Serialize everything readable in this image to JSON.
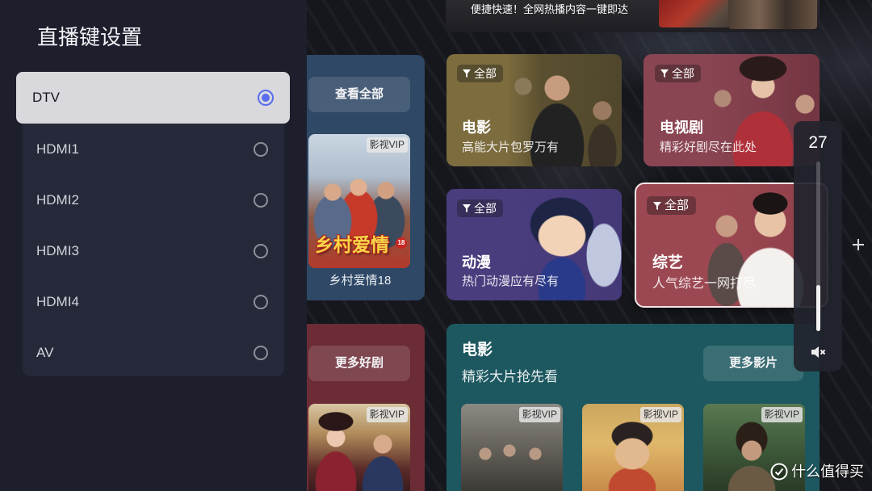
{
  "settings_panel": {
    "title": "直播键设置",
    "options": [
      {
        "label": "DTV",
        "selected": true
      },
      {
        "label": "HDMI1",
        "selected": false
      },
      {
        "label": "HDMI2",
        "selected": false
      },
      {
        "label": "HDMI3",
        "selected": false
      },
      {
        "label": "HDMI4",
        "selected": false
      },
      {
        "label": "AV",
        "selected": false
      }
    ]
  },
  "banner": {
    "text": "便捷快速！全网热播内容一键即达"
  },
  "featured_card": {
    "button": "查看全部",
    "poster": {
      "badge": "影视VIP",
      "title": "乡村爱情",
      "episode": "18"
    },
    "caption": "乡村爱情18"
  },
  "drama_card": {
    "button": "更多好剧",
    "poster": {
      "badge": "影视VIP"
    }
  },
  "categories": [
    {
      "filter": "全部",
      "title": "电影",
      "subtitle": "高能大片包罗万有",
      "color": "#7c6c3e",
      "focused": false
    },
    {
      "filter": "全部",
      "title": "电视剧",
      "subtitle": "精彩好剧尽在此处",
      "color": "#8a4552",
      "focused": false
    },
    {
      "filter": "全部",
      "title": "动漫",
      "subtitle": "热门动漫应有尽有",
      "color": "#4a3d7e",
      "focused": false
    },
    {
      "filter": "全部",
      "title": "综艺",
      "subtitle": "人气综艺一网打尽",
      "color": "#9c4852",
      "focused": true
    }
  ],
  "movie_section": {
    "title": "电影",
    "subtitle": "精彩大片抢先看",
    "button": "更多影片",
    "posters": [
      {
        "badge": "影视VIP"
      },
      {
        "badge": "影视VIP"
      },
      {
        "badge": "影视VIP"
      }
    ]
  },
  "volume": {
    "level": 27
  },
  "watermark": "什么值得买",
  "icons": {
    "filter": "filter-icon",
    "mute": "volume-mute-icon",
    "plus": "plus-icon",
    "watermark_logo": "watermark-logo-icon"
  },
  "colors": {
    "accent": "#5b6cf0",
    "panel": "#1d1f2d",
    "selected_row": "#d8d8dd",
    "featured_card": "#2e4866",
    "drama_card": "#6c2c36",
    "movie_section": "#1d5860"
  }
}
